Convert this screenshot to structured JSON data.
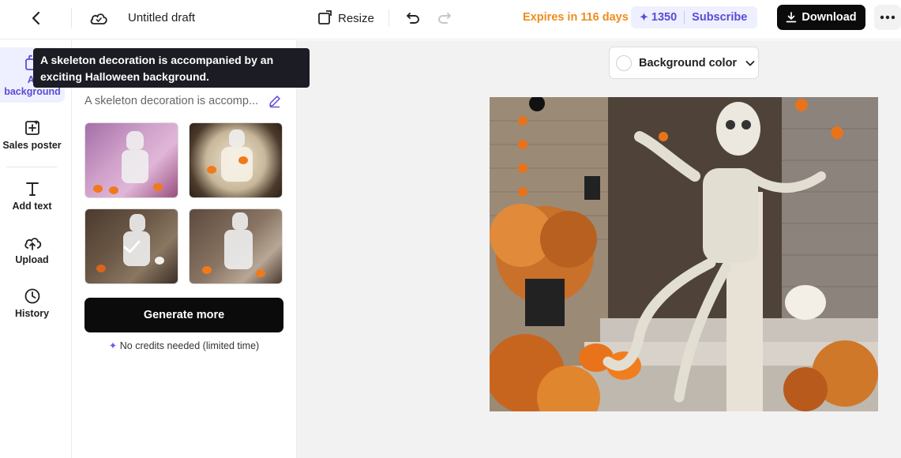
{
  "topbar": {
    "title": "Untitled draft",
    "resize_label": "Resize",
    "expires": "Expires in 116 days",
    "credits": "1350",
    "subscribe": "Subscribe",
    "download": "Download"
  },
  "nav": {
    "ai_background_label": "AI background",
    "sales_poster": "Sales poster",
    "add_text": "Add text",
    "upload": "Upload",
    "history": "History"
  },
  "panel": {
    "prompt": "A skeleton decoration is accomp...",
    "generate_more": "Generate more",
    "no_credits": "No credits needed (limited time)"
  },
  "tooltip": {
    "text": "A skeleton decoration is accompanied by an exciting Halloween background."
  },
  "canvas": {
    "background_color": "Background color"
  },
  "colors": {
    "accent": "#5b4bd6",
    "expires": "#f08c1c",
    "primary": "#0b0b0b"
  }
}
